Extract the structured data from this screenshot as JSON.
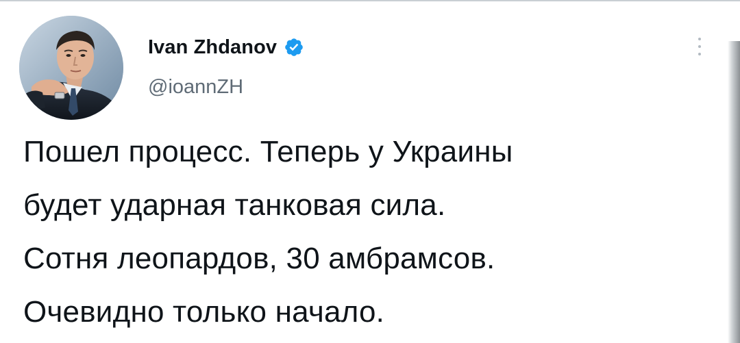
{
  "tweet": {
    "author": {
      "display_name": "Ivan Zhdanov",
      "handle": "@ioannZH",
      "verified": true,
      "avatar": "profile-photo",
      "verified_icon": "verified-badge-icon"
    },
    "text": "Пошел процесс. Теперь у Украины\nбудет ударная танковая сила.\nСотня леопардов, 30 амбрамсов.\nОчевидно только начало.",
    "more_menu_icon": "more-vertical-icon"
  },
  "colors": {
    "verified_blue": "#1d9bf0",
    "handle_gray": "#5f6b76",
    "text": "#0f1419",
    "background": "#ffffff"
  }
}
